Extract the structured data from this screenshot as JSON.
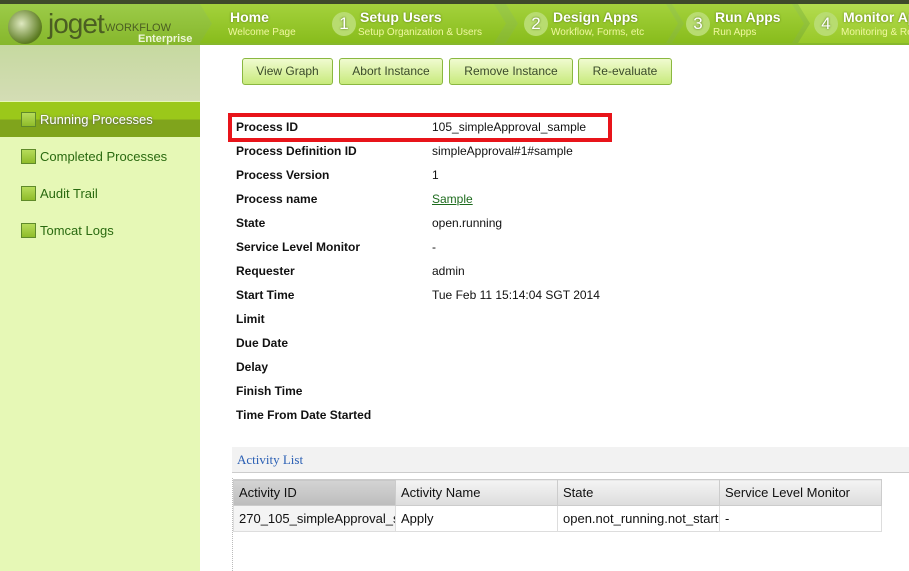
{
  "brand": {
    "logo": "joget",
    "workflow": "WORKFLOW",
    "edition": "Enterprise"
  },
  "steps": [
    {
      "num": "",
      "title": "Home",
      "sub": "Welcome Page"
    },
    {
      "num": "1",
      "title": "Setup Users",
      "sub": "Setup Organization & Users"
    },
    {
      "num": "2",
      "title": "Design Apps",
      "sub": "Workflow, Forms, etc"
    },
    {
      "num": "3",
      "title": "Run Apps",
      "sub": "Run Apps"
    },
    {
      "num": "4",
      "title": "Monitor Apps",
      "sub": "Monitoring & Reports"
    }
  ],
  "sidebar": {
    "items": [
      {
        "label": "Running Processes",
        "active": true
      },
      {
        "label": "Completed Processes"
      },
      {
        "label": "Audit Trail"
      },
      {
        "label": "Tomcat Logs"
      }
    ]
  },
  "toolbar": {
    "view_graph": "View Graph",
    "abort": "Abort Instance",
    "remove": "Remove Instance",
    "reevaluate": "Re-evaluate"
  },
  "details": [
    {
      "label": "Process ID",
      "value": "105_simpleApproval_sample"
    },
    {
      "label": "Process Definition ID",
      "value": "simpleApproval#1#sample"
    },
    {
      "label": "Process Version",
      "value": "1"
    },
    {
      "label": "Process name",
      "value": "Sample"
    },
    {
      "label": "State",
      "value": "open.running"
    },
    {
      "label": "Service Level Monitor",
      "value": "-"
    },
    {
      "label": "Requester",
      "value": "admin"
    },
    {
      "label": "Start Time",
      "value": "Tue Feb 11 15:14:04 SGT 2014"
    },
    {
      "label": "Limit",
      "value": ""
    },
    {
      "label": "Due Date",
      "value": ""
    },
    {
      "label": "Delay",
      "value": ""
    },
    {
      "label": "Finish Time",
      "value": ""
    },
    {
      "label": "Time From Date Started",
      "value": ""
    }
  ],
  "activity_list": {
    "title": "Activity List",
    "columns": [
      "Activity ID",
      "Activity Name",
      "State",
      "Service Level Monitor"
    ],
    "rows": [
      [
        "270_105_simpleApproval_s",
        "Apply",
        "open.not_running.not_start",
        "-"
      ]
    ]
  },
  "colors": {
    "highlight": "#e8141a",
    "accent": "#8bbd22"
  }
}
